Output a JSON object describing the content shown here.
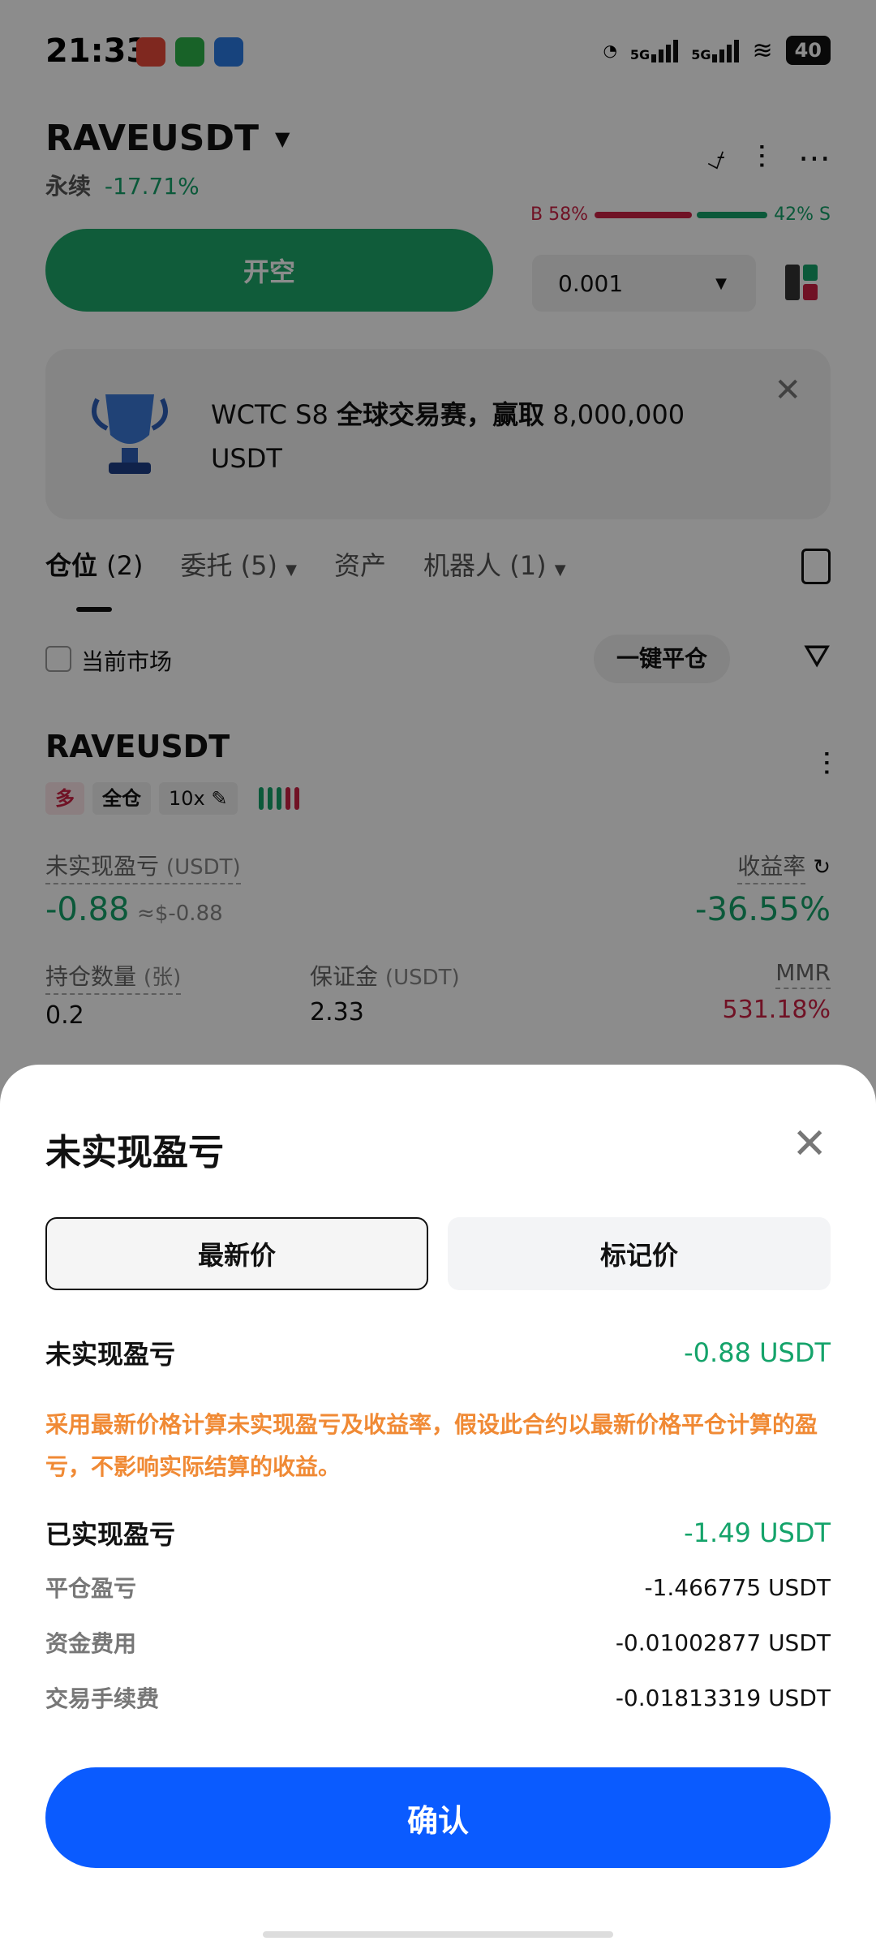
{
  "status_bar": {
    "time": "21:33",
    "network1": "5G",
    "network2": "5G",
    "battery": "40",
    "icons": [
      "speed-icon",
      "signal-icon",
      "signal-icon",
      "wifi-icon",
      "battery-icon"
    ]
  },
  "header": {
    "symbol": "RAVEUSDT",
    "contract_type": "永续",
    "change": "-17.71%",
    "buy_ratio": "B 58%",
    "sell_ratio": "42% S",
    "buy_fraction": 0.58,
    "sell_fraction": 0.42
  },
  "trade": {
    "open_short_label": "开空",
    "quantity_value": "0.001"
  },
  "banner": {
    "text_prefix": "WCTC S8 ",
    "text_bold": "全球交易赛，赢取",
    "text_suffix": " 8,000,000 USDT"
  },
  "tabs": [
    {
      "label": "仓位",
      "count": "(2)"
    },
    {
      "label": "委托",
      "count": "(5)"
    },
    {
      "label": "资产",
      "count": ""
    },
    {
      "label": "机器人",
      "count": "(1)"
    }
  ],
  "filters": {
    "current_market_label": "当前市场",
    "close_all_label": "一键平仓"
  },
  "position": {
    "symbol": "RAVEUSDT",
    "side_tag": "多",
    "margin_mode": "全仓",
    "leverage": "10x",
    "unrealized_label": "未实现盈亏",
    "unrealized_unit": "(USDT)",
    "unrealized_value": "-0.88",
    "unrealized_usd": "≈$-0.88",
    "roe_label": "收益率",
    "roe_value": "-36.55%",
    "size_label": "持仓数量",
    "size_unit": "(张)",
    "size_value": "0.2",
    "margin_label": "保证金",
    "margin_unit": "(USDT)",
    "margin_value": "2.33",
    "mmr_label": "MMR",
    "mmr_value": "531.18%"
  },
  "sheet": {
    "title": "未实现盈亏",
    "seg_latest": "最新价",
    "seg_mark": "标记价",
    "unrealized_label": "未实现盈亏",
    "unrealized_value": "-0.88 USDT",
    "note": "采用最新价格计算未实现盈亏及收益率，假设此合约以最新价格平仓计算的盈亏，不影响实际结算的收益。",
    "realized_label": "已实现盈亏",
    "realized_value": "-1.49 USDT",
    "close_pnl_label": "平仓盈亏",
    "close_pnl_value": "-1.466775 USDT",
    "funding_label": "资金费用",
    "funding_value": "-0.01002877 USDT",
    "fee_label": "交易手续费",
    "fee_value": "-0.01813319 USDT",
    "confirm_label": "确认"
  },
  "colors": {
    "green": "#14a36a",
    "red": "#cc2244",
    "blue": "#0a5bff",
    "orange": "#f08a35"
  }
}
